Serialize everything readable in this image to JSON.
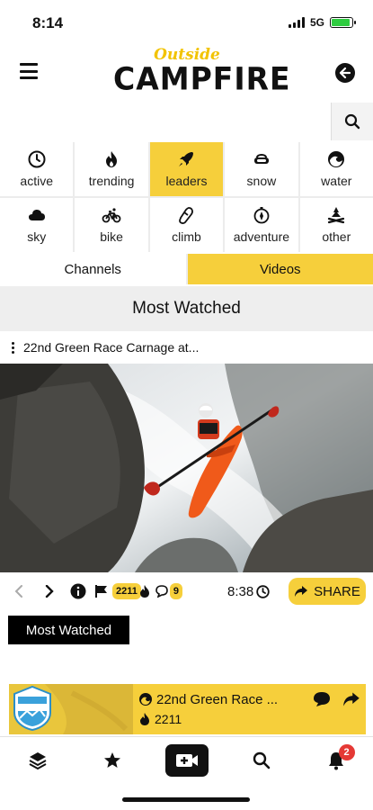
{
  "status_bar": {
    "time": "8:14",
    "network": "5G",
    "battery_fraction": 0.9
  },
  "header": {
    "logo_top": "Outside",
    "logo_main": "CAMPFIRE",
    "menu_icon": "hamburger-icon",
    "back_icon": "back-arrow-icon"
  },
  "search": {
    "value": "",
    "placeholder": "",
    "icon": "search-icon"
  },
  "categories": [
    {
      "label": "active",
      "icon": "clock-icon",
      "selected": false
    },
    {
      "label": "trending",
      "icon": "flame-icon",
      "selected": false
    },
    {
      "label": "leaders",
      "icon": "rocket-icon",
      "selected": true
    },
    {
      "label": "snow",
      "icon": "goggles-icon",
      "selected": false
    },
    {
      "label": "water",
      "icon": "wave-icon",
      "selected": false
    },
    {
      "label": "sky",
      "icon": "cloud-icon",
      "selected": false
    },
    {
      "label": "bike",
      "icon": "bicycle-icon",
      "selected": false
    },
    {
      "label": "climb",
      "icon": "carabiner-icon",
      "selected": false
    },
    {
      "label": "adventure",
      "icon": "compass-icon",
      "selected": false
    },
    {
      "label": "other",
      "icon": "campfire-icon",
      "selected": false
    }
  ],
  "segments": {
    "channels": "Channels",
    "videos": "Videos",
    "active": "videos"
  },
  "section_title": "Most Watched",
  "video": {
    "title": "22nd Green Race Carnage at...",
    "view_count": "2211",
    "comment_count": "9",
    "duration": "8:38",
    "share_label": "SHARE"
  },
  "tag_label": "Most Watched",
  "now_playing": {
    "title": "22nd Green Race ...",
    "count": "2211"
  },
  "tab_bar": {
    "items": [
      "layers-icon",
      "star-icon",
      "video-add-icon",
      "search-icon",
      "bell-icon"
    ],
    "notification_count": "2"
  },
  "colors": {
    "accent": "#f6cf3b",
    "logo_yellow": "#f2c300",
    "badge_red": "#e53935"
  }
}
